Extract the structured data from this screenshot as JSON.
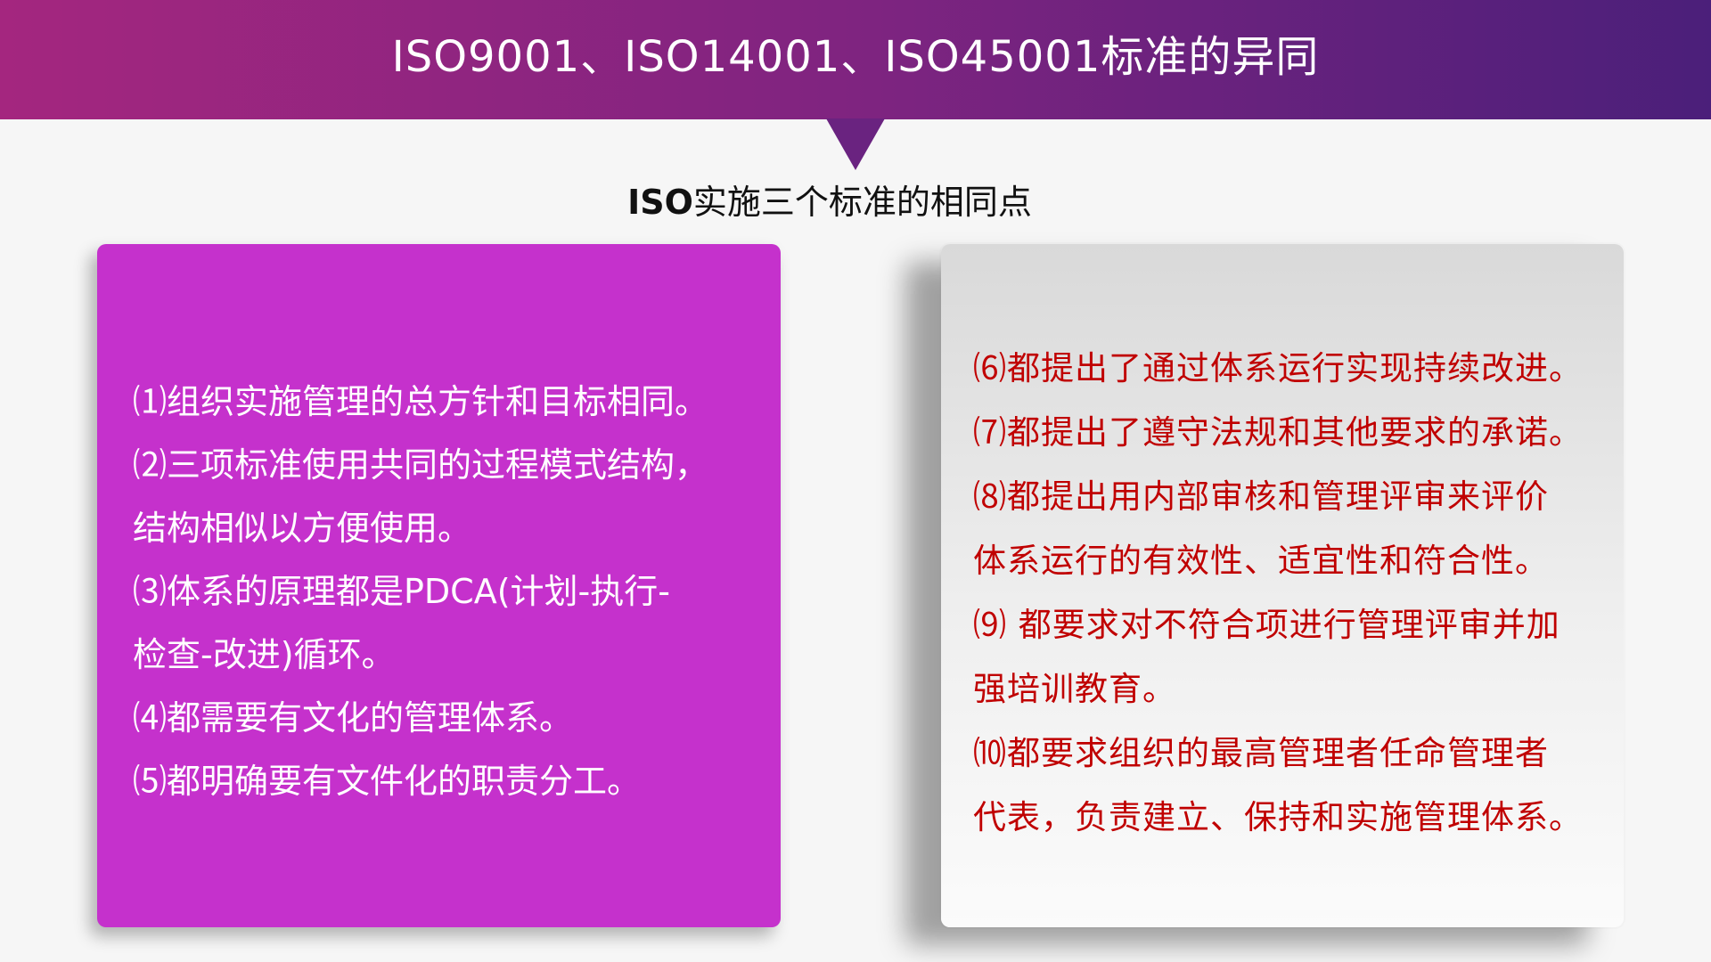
{
  "header": {
    "title": "ISO9001、ISO14001、ISO45001标准的异同"
  },
  "subtitle": {
    "bold_prefix": "ISO",
    "text": "实施三个标准的相同点"
  },
  "left_card": {
    "lines": [
      "⑴组织实施管理的总方针和目标相同。",
      "⑵三项标准使用共同的过程模式结构，",
      "结构相似以方便使用。",
      "⑶体系的原理都是PDCA(计划-执行-",
      "检查-改进)循环。",
      "⑷都需要有文化的管理体系。",
      "⑸都明确要有文件化的职责分工。"
    ]
  },
  "right_card": {
    "lines": [
      "⑹都提出了通过体系运行实现持续改进。",
      "⑺都提出了遵守法规和其他要求的承诺。",
      "⑻都提出用内部审核和管理评审来评价",
      "体系运行的有效性、适宜性和符合性。",
      "⑼ 都要求对不符合项进行管理评审并加",
      "强培训教育。",
      "⑽都要求组织的最高管理者任命管理者",
      "代表，负责建立、保持和实施管理体系。"
    ]
  },
  "colors": {
    "header_gradient_start": "#a4267f",
    "header_gradient_end": "#4b1f7a",
    "left_card_bg": "#c531cc",
    "right_card_text": "#c00000"
  }
}
